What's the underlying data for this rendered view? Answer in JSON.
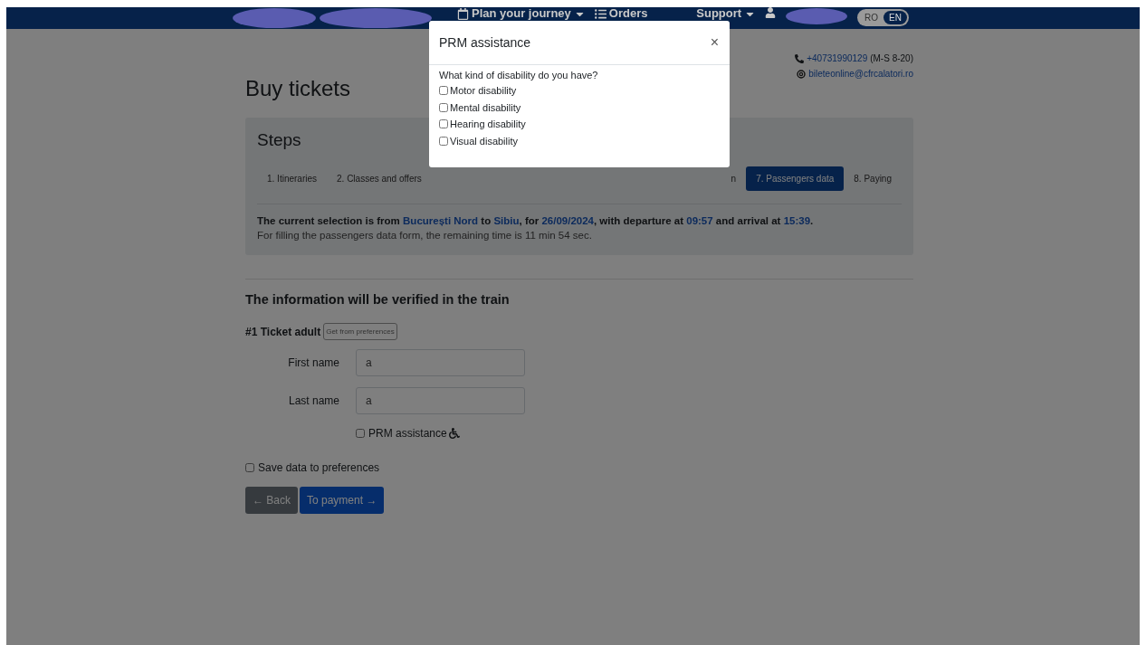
{
  "nav": {
    "items": [
      {
        "label": "Plan your journey",
        "kind": "dropdown"
      },
      {
        "label": "Orders",
        "kind": "link"
      },
      {
        "label": "Support",
        "kind": "dropdown"
      }
    ],
    "languages": [
      {
        "label": "RO",
        "selected": false
      },
      {
        "label": "EN",
        "selected": true
      }
    ]
  },
  "contact": {
    "phone": "+40731990129",
    "phone_hours": "(M-S 8-20)",
    "email": "bileteonline@cfrcalatori.ro"
  },
  "title": "Buy tickets",
  "steps_panel": {
    "title": "Steps",
    "steps": [
      {
        "label": "1. Itineraries",
        "selected": false
      },
      {
        "label": "2. Classes and offers",
        "selected": false
      },
      {
        "label": "n",
        "selected": false
      },
      {
        "label": "7. Passengers data",
        "selected": true
      },
      {
        "label": "8. Paying",
        "selected": false
      }
    ],
    "selection": [
      {
        "text": "The current selection is from ",
        "kind": "plain"
      },
      {
        "text": "București Nord",
        "kind": "link"
      },
      {
        "text": " to ",
        "kind": "plain"
      },
      {
        "text": "Sibiu",
        "kind": "link"
      },
      {
        "text": ", for ",
        "kind": "plain"
      },
      {
        "text": "26/09/2024",
        "kind": "link"
      },
      {
        "text": ", with departure at ",
        "kind": "plain"
      },
      {
        "text": "09:57",
        "kind": "link"
      },
      {
        "text": " and arrival at ",
        "kind": "plain"
      },
      {
        "text": "15:39",
        "kind": "link"
      },
      {
        "text": ".",
        "kind": "plain"
      }
    ],
    "remaining": "For filling the passengers data form, the remaining time is 11 min 54 sec."
  },
  "form": {
    "heading": "The information will be verified in the train",
    "ticket_label": "#1 Ticket adult",
    "preferences_button": "Get from preferences",
    "fields": [
      {
        "label": "First name",
        "value": "a"
      },
      {
        "label": "Last name",
        "value": "a"
      }
    ],
    "prm": {
      "label": "PRM assistance",
      "checked": false
    },
    "save": {
      "label": "Save data to preferences",
      "checked": false
    },
    "buttons": [
      {
        "label": "← Back",
        "kind": "secondary"
      },
      {
        "label": "To payment →",
        "kind": "primary"
      }
    ]
  },
  "modal": {
    "title": "PRM assistance",
    "close": "×",
    "question": "What kind of disability do you have?",
    "options": [
      {
        "label": "Motor disability",
        "checked": false
      },
      {
        "label": "Mental disability",
        "checked": false
      },
      {
        "label": "Hearing disability",
        "checked": false
      },
      {
        "label": "Visual disability",
        "checked": false
      }
    ]
  }
}
